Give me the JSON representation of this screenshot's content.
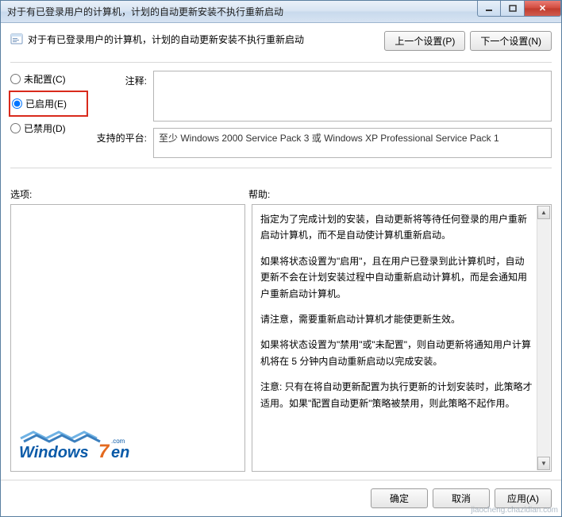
{
  "window": {
    "title": "对于有已登录用户的计算机，计划的自动更新安装不执行重新启动"
  },
  "header": {
    "text": "对于有已登录用户的计算机，计划的自动更新安装不执行重新启动",
    "prev_btn": "上一个设置(P)",
    "next_btn": "下一个设置(N)"
  },
  "radios": {
    "not_configured": "未配置(C)",
    "enabled": "已启用(E)",
    "disabled": "已禁用(D)"
  },
  "fields": {
    "comment_label": "注释:",
    "comment_value": "",
    "platform_label": "支持的平台:",
    "platform_value": "至少 Windows 2000 Service Pack 3 或 Windows XP Professional Service Pack 1"
  },
  "mid": {
    "options_label": "选项:",
    "help_label": "帮助:"
  },
  "help": {
    "p1": "指定为了完成计划的安装，自动更新将等待任何登录的用户重新启动计算机，而不是自动使计算机重新启动。",
    "p2": "如果将状态设置为\"启用\"，且在用户已登录到此计算机时，自动更新不会在计划安装过程中自动重新启动计算机，而是会通知用户重新启动计算机。",
    "p3": "请注意，需要重新启动计算机才能使更新生效。",
    "p4": "如果将状态设置为\"禁用\"或\"未配置\"，则自动更新将通知用户计算机将在 5 分钟内自动重新启动以完成安装。",
    "p5": "注意: 只有在将自动更新配置为执行更新的计划安装时，此策略才适用。如果\"配置自动更新\"策略被禁用，则此策略不起作用。"
  },
  "footer": {
    "ok": "确定",
    "cancel": "取消",
    "apply": "应用(A)"
  },
  "watermark": "jiaocheng.chazidian.com"
}
